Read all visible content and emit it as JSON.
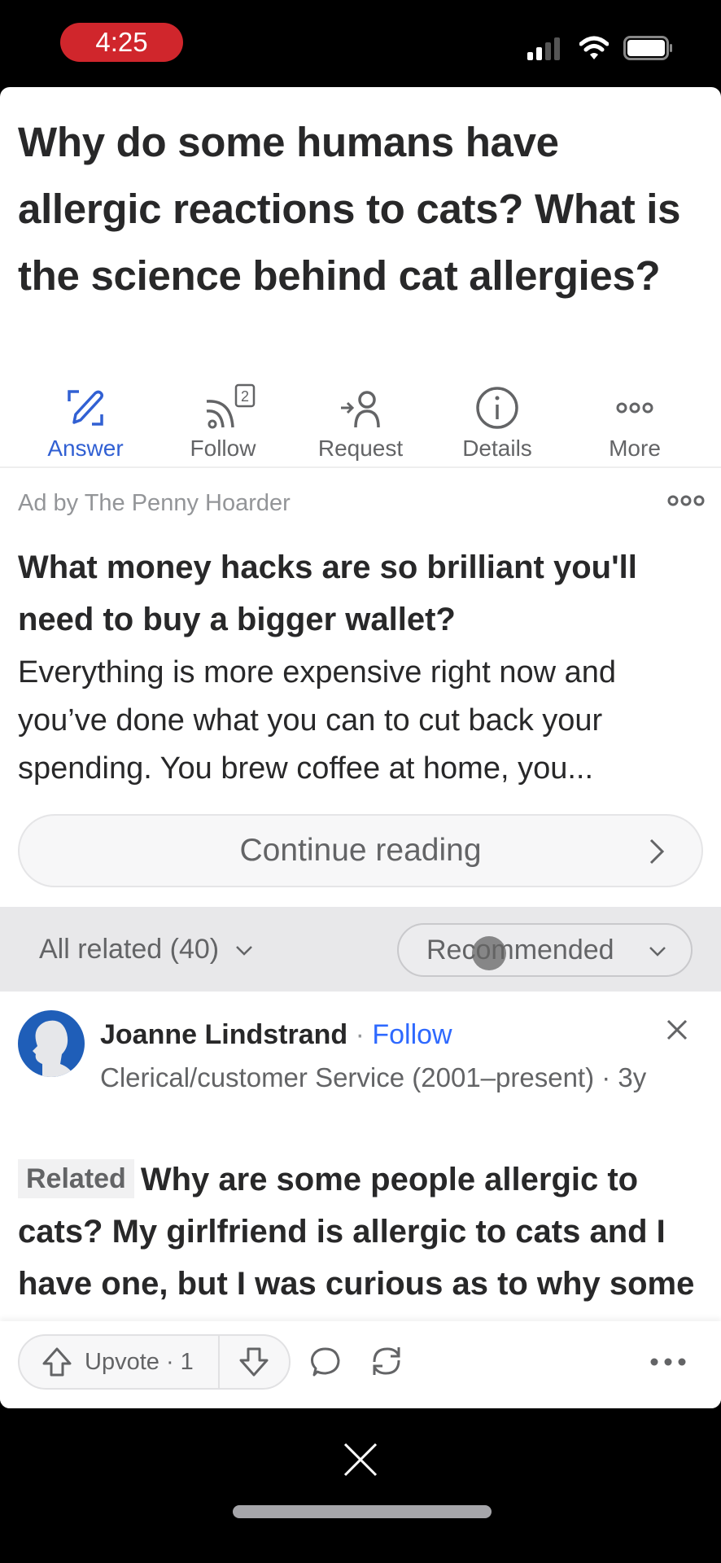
{
  "status_bar": {
    "time": "4:25",
    "time_pill_color": "#d0262c",
    "icons": [
      "cellular-signal-icon",
      "wifi-icon",
      "battery-icon"
    ]
  },
  "question": {
    "title": "Why do some humans have allergic reactions to cats? What is the science behind cat allergies?"
  },
  "actions": [
    {
      "label": "Answer",
      "icon": "pencil-edit-icon",
      "active": true
    },
    {
      "label": "Follow",
      "icon": "rss-follow-icon",
      "badge": "2"
    },
    {
      "label": "Request",
      "icon": "request-user-icon"
    },
    {
      "label": "Details",
      "icon": "info-icon"
    },
    {
      "label": "More",
      "icon": "more-dots-icon"
    }
  ],
  "ad": {
    "by_line": "Ad by The Penny Hoarder",
    "title": "What money hacks are so brilliant you'll need to buy a bigger wallet?",
    "body": "Everything is more expensive right now and you’ve done what you can to cut back your spending. You brew coffee at home, you...",
    "continue_label": "Continue reading"
  },
  "related_bar": {
    "all_related_label": "All related (40)",
    "sort_label": "Recommended"
  },
  "answer": {
    "author_name": "Joanne Lindstrand",
    "separator": " · ",
    "follow_label": "Follow",
    "credential": "Clerical/customer Service (2001–present) · 3y",
    "related_tag": "Related",
    "related_question": "Why are some people allergic to cats? My girlfriend is allergic to cats and I have one, but I was curious as to why some people are allergic to them?"
  },
  "bottom_bar": {
    "upvote_label": "Upvote · 1"
  },
  "colors": {
    "accent_blue": "#2e69ff",
    "text_primary": "#282829",
    "text_secondary": "#636466"
  }
}
